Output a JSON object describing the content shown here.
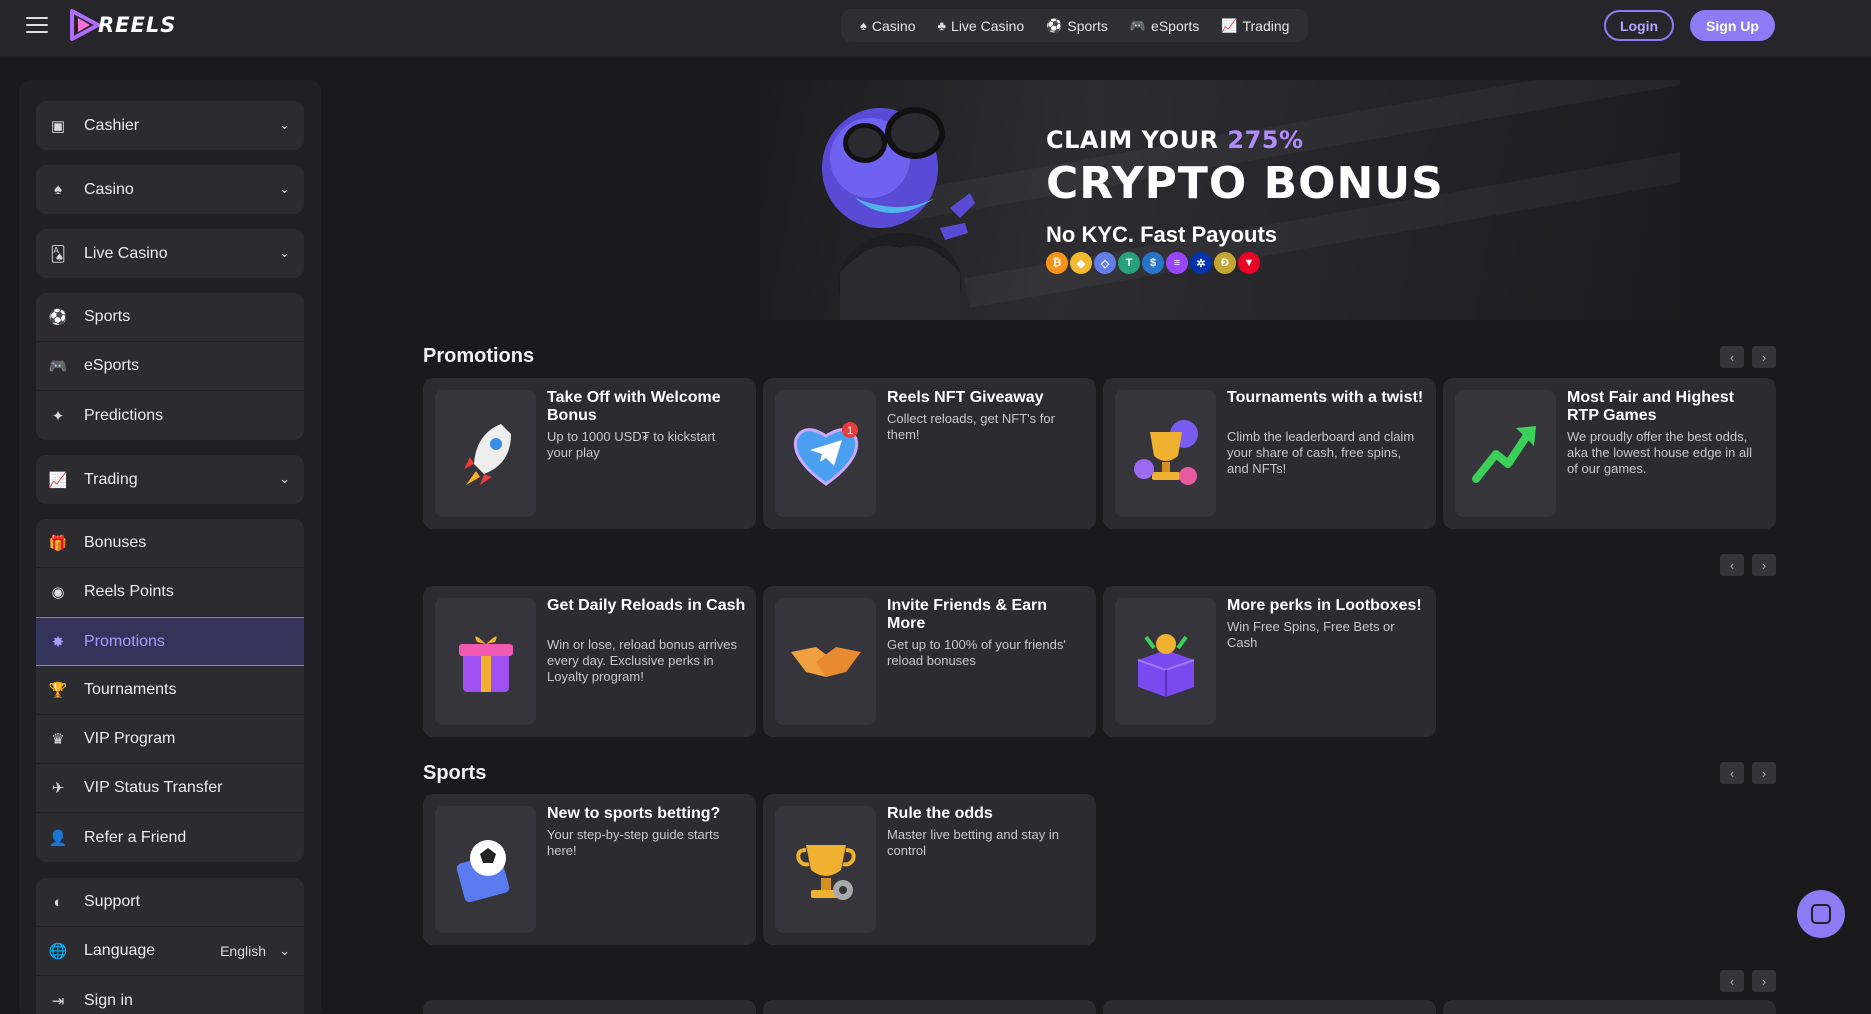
{
  "header": {
    "logo_text": "REELS",
    "nav": [
      {
        "label": "Casino",
        "icon": "casino-icon"
      },
      {
        "label": "Live Casino",
        "icon": "live-casino-icon"
      },
      {
        "label": "Sports",
        "icon": "soccer-ball-icon"
      },
      {
        "label": "eSports",
        "icon": "gamepad-icon"
      },
      {
        "label": "Trading",
        "icon": "chart-icon"
      }
    ],
    "login_label": "Login",
    "signup_label": "Sign Up"
  },
  "sidebar": {
    "cashier": "Cashier",
    "casino": "Casino",
    "live_casino": "Live Casino",
    "sports": "Sports",
    "esports": "eSports",
    "predictions": "Predictions",
    "trading": "Trading",
    "bonuses": "Bonuses",
    "reels_points": "Reels Points",
    "promotions": "Promotions",
    "tournaments": "Tournaments",
    "vip_program": "VIP Program",
    "vip_status_transfer": "VIP Status Transfer",
    "refer_a_friend": "Refer a Friend",
    "support": "Support",
    "language": "Language",
    "language_value": "English",
    "sign_in": "Sign in"
  },
  "hero": {
    "claim_prefix": "CLAIM YOUR",
    "claim_pct": "275%",
    "title": "CRYPTO BONUS",
    "subtitle": "No KYC. Fast Payouts",
    "coins": [
      {
        "symbol": "₿",
        "color": "#f7931a"
      },
      {
        "symbol": "◆",
        "color": "#f3ba2f"
      },
      {
        "symbol": "◇",
        "color": "#627eea"
      },
      {
        "symbol": "T",
        "color": "#26a17b"
      },
      {
        "symbol": "$",
        "color": "#2775ca"
      },
      {
        "symbol": "≡",
        "color": "#9945ff"
      },
      {
        "symbol": "✲",
        "color": "#0033ad"
      },
      {
        "symbol": "Ð",
        "color": "#c2a633"
      },
      {
        "symbol": "▼",
        "color": "#ef0027"
      }
    ]
  },
  "sections": {
    "promotions_title": "Promotions",
    "sports_title": "Sports"
  },
  "promo_cards": [
    {
      "title": "Take Off with Welcome Bonus",
      "desc": "Up to 1000 USD₮ to kickstart your play"
    },
    {
      "title": "Reels NFT Giveaway",
      "desc": "Collect reloads, get NFT's for them!"
    },
    {
      "title": "Tournaments with a twist!",
      "desc": "Climb the leaderboard and claim your share of cash, free spins, and NFTs!"
    },
    {
      "title": "Most Fair and Highest RTP Games",
      "desc": "We proudly offer the best odds, aka the lowest house edge in all of our games."
    },
    {
      "title": "Get Daily Reloads in Cash",
      "desc": "Win or lose, reload bonus arrives every day. Exclusive perks in Loyalty program!"
    },
    {
      "title": "Invite Friends & Earn More",
      "desc": "Get up to 100% of your friends' reload bonuses"
    },
    {
      "title": "More perks in Lootboxes!",
      "desc": "Win Free Spins, Free Bets or Cash"
    }
  ],
  "sports_cards": [
    {
      "title": "New to sports betting?",
      "desc": "Your step-by-step guide starts here!"
    },
    {
      "title": "Rule the odds",
      "desc": "Master live betting and stay in control"
    }
  ],
  "nft_badge": "1"
}
